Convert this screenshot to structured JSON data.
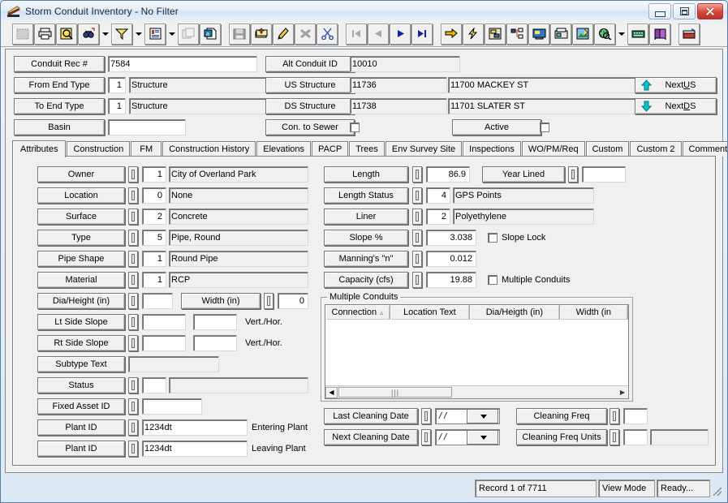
{
  "window": {
    "title": "Storm Conduit Inventory - No Filter",
    "icon": "conduit-icon",
    "controls": {
      "minimize": "minimize",
      "maximize": "maximize",
      "close": "close"
    }
  },
  "toolbar": {
    "items": [
      {
        "name": "select-area-icon",
        "disabled": true,
        "framed": true
      },
      {
        "name": "print-icon",
        "disabled": false,
        "framed": true
      },
      {
        "name": "print-preview-icon",
        "disabled": false,
        "framed": true
      },
      {
        "name": "find-icon",
        "disabled": false,
        "framed": true
      },
      {
        "name": "find-dropdown-arrow",
        "dropdown": true
      },
      {
        "name": "filter-icon",
        "disabled": false,
        "framed": true
      },
      {
        "name": "filter-dropdown-arrow",
        "dropdown": true
      },
      {
        "name": "report-icon",
        "disabled": false,
        "framed": true
      },
      {
        "name": "report-dropdown-arrow",
        "dropdown": true
      },
      {
        "name": "copy-record-icon",
        "disabled": true,
        "framed": true
      },
      {
        "name": "export-icon",
        "disabled": false,
        "framed": true
      },
      {
        "name": "save-icon",
        "disabled": true,
        "framed": true
      },
      {
        "name": "add-record-icon",
        "disabled": false,
        "framed": true
      },
      {
        "name": "edit-record-icon",
        "disabled": false,
        "framed": true
      },
      {
        "name": "delete-record-icon",
        "disabled": true,
        "framed": true
      },
      {
        "name": "cut-icon",
        "disabled": false,
        "framed": true
      },
      {
        "name": "first-record-icon",
        "disabled": true,
        "framed": true
      },
      {
        "name": "previous-record-icon",
        "disabled": true,
        "framed": true
      },
      {
        "name": "next-record-icon",
        "disabled": false,
        "framed": true
      },
      {
        "name": "last-record-icon",
        "disabled": false,
        "framed": true
      },
      {
        "name": "goto-icon",
        "disabled": false,
        "framed": true
      },
      {
        "name": "lightning-icon",
        "disabled": false,
        "framed": true
      },
      {
        "name": "layout-icon",
        "disabled": false,
        "framed": true
      },
      {
        "name": "tree-view-icon",
        "disabled": false,
        "framed": true
      },
      {
        "name": "monitor-icon",
        "disabled": false,
        "framed": true
      },
      {
        "name": "fax-icon",
        "disabled": false,
        "framed": true
      },
      {
        "name": "picture-edit-icon",
        "disabled": false,
        "framed": true
      },
      {
        "name": "globe-search-icon",
        "disabled": false,
        "framed": true
      },
      {
        "name": "globe-dropdown-arrow",
        "dropdown": true
      },
      {
        "name": "keyboard-icon",
        "disabled": false,
        "framed": true
      },
      {
        "name": "help-book-icon",
        "disabled": false,
        "framed": true
      },
      {
        "name": "exit-icon",
        "disabled": false,
        "framed": true
      }
    ]
  },
  "header": {
    "conduit_rec_label": "Conduit Rec #",
    "conduit_rec_value": "7584",
    "from_end_type_label": "From End Type",
    "from_end_type_code": "1",
    "from_end_type_value": "Structure",
    "to_end_type_label": "To End Type",
    "to_end_type_code": "1",
    "to_end_type_value": "Structure",
    "basin_label": "Basin",
    "basin_value": "",
    "alt_conduit_id_label": "Alt Conduit ID",
    "alt_conduit_id_value": "10010",
    "us_structure_label": "US Structure",
    "us_structure_id": "11736",
    "us_structure_desc": "11700   MACKEY ST",
    "ds_structure_label": "DS Structure",
    "ds_structure_id": "11738",
    "ds_structure_desc": "11701   SLATER ST",
    "con_to_sewer_label": "Con. to Sewer",
    "con_to_sewer_checked": false,
    "active_label": "Active",
    "active_checked": false,
    "next_us_label": "Next US",
    "next_us_accel": "U",
    "next_ds_label": "Next DS",
    "next_ds_accel": "D",
    "up_arrow_icon": "arrow-up-icon",
    "down_arrow_icon": "arrow-down-icon",
    "accent_arrow_color": "#00c0c8"
  },
  "tabs": [
    {
      "label": "Attributes",
      "active": true
    },
    {
      "label": "Construction",
      "active": false
    },
    {
      "label": "FM",
      "active": false
    },
    {
      "label": "Construction History",
      "active": false
    },
    {
      "label": "Elevations",
      "active": false
    },
    {
      "label": "PACP",
      "active": false
    },
    {
      "label": "Trees",
      "active": false
    },
    {
      "label": "Env Survey Site",
      "active": false
    },
    {
      "label": "Inspections",
      "active": false
    },
    {
      "label": "WO/PM/Req",
      "active": false
    },
    {
      "label": "Custom",
      "active": false
    },
    {
      "label": "Custom 2",
      "active": false
    },
    {
      "label": "Comments",
      "active": false
    }
  ],
  "attributes": {
    "left_fields": [
      {
        "label": "Owner",
        "code": "1",
        "value": "City of Overland Park"
      },
      {
        "label": "Location",
        "code": "0",
        "value": "None"
      },
      {
        "label": "Surface",
        "code": "2",
        "value": "Concrete"
      },
      {
        "label": "Type",
        "code": "5",
        "value": "Pipe, Round"
      },
      {
        "label": "Pipe Shape",
        "code": "1",
        "value": "Round Pipe"
      },
      {
        "label": "Material",
        "code": "1",
        "value": "RCP"
      }
    ],
    "dia_height_label": "Dia/Height (in)",
    "dia_height_value": "",
    "width_label": "Width (in)",
    "width_value": "0",
    "lt_side_slope_label": "Lt Side Slope",
    "lt_side_slope_a": "",
    "lt_side_slope_b": "",
    "lt_side_slope_unit": "Vert./Hor.",
    "rt_side_slope_label": "Rt Side Slope",
    "rt_side_slope_a": "",
    "rt_side_slope_b": "",
    "rt_side_slope_unit": "Vert./Hor.",
    "subtype_text_label": "Subtype Text",
    "subtype_text_value": "",
    "status_label": "Status",
    "status_code": "",
    "status_value": "",
    "fixed_asset_id_label": "Fixed Asset ID",
    "fixed_asset_id_value": "",
    "plant_id_entering_label": "Plant ID",
    "plant_id_entering_value": "1234dt",
    "entering_plant_label": "Entering Plant",
    "plant_id_leaving_label": "Plant ID",
    "plant_id_leaving_value": "1234dt",
    "leaving_plant_label": "Leaving Plant"
  },
  "right_panel": {
    "length_label": "Length",
    "length_value": "86.9",
    "year_lined_label": "Year Lined",
    "year_lined_value": "",
    "length_status_label": "Length Status",
    "length_status_code": "4",
    "length_status_value": "GPS Points",
    "liner_label": "Liner",
    "liner_code": "2",
    "liner_value": "Polyethylene",
    "slope_label": "Slope %",
    "slope_value": "3.038",
    "slope_lock_label": "Slope Lock",
    "slope_lock_checked": false,
    "mannings_label": "Manning's \"n\"",
    "mannings_value": "0.012",
    "capacity_label": "Capacity (cfs)",
    "capacity_value": "19.88",
    "multiple_conduits_cb_label": "Multiple Conduits",
    "multiple_conduits_checked": false
  },
  "multiple_conduits": {
    "group_title": "Multiple Conduits",
    "columns": [
      "Connection",
      "Location Text",
      "Dia/Heigth (in)",
      "Width (in"
    ],
    "sort_indicator": "▵",
    "rows": [],
    "scroll_left_icon": "scroll-left-arrow",
    "scroll_right_icon": "scroll-right-arrow",
    "thumb_grip": "|||"
  },
  "cleaning": {
    "last_cleaning_date_label": "Last Cleaning Date",
    "last_cleaning_date_value": "/  /",
    "next_cleaning_date_label": "Next Cleaning Date",
    "next_cleaning_date_value": "/  /",
    "cleaning_freq_label": "Cleaning Freq",
    "cleaning_freq_value": "",
    "cleaning_freq_units_label": "Cleaning Freq Units",
    "cleaning_freq_units_code": "",
    "cleaning_freq_units_value": ""
  },
  "status_bar": {
    "record": "Record 1 of 7711",
    "mode": "View Mode",
    "state": "Ready..."
  }
}
